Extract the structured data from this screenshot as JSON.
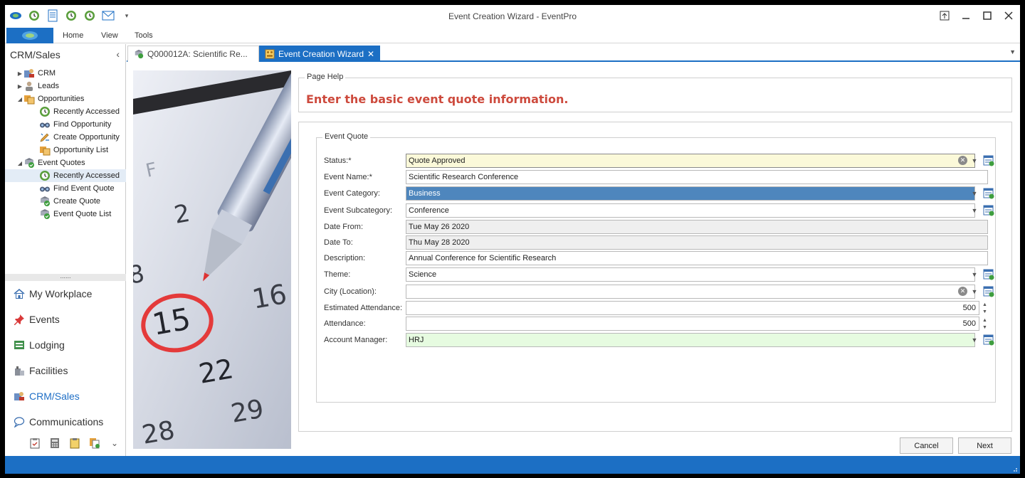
{
  "window": {
    "title": "Event Creation Wizard - EventPro"
  },
  "qat": {
    "icons": [
      "eventpro-logo-icon",
      "refresh-icon",
      "document-icon",
      "clock-icon",
      "clock-icon",
      "mail-icon",
      "customize-icon"
    ]
  },
  "ribbon": {
    "tabs": [
      "Home",
      "View",
      "Tools"
    ]
  },
  "nav": {
    "header": "CRM/Sales",
    "tree": [
      {
        "label": "CRM",
        "level": 1,
        "expanded": false
      },
      {
        "label": "Leads",
        "level": 1,
        "expanded": false
      },
      {
        "label": "Opportunities",
        "level": 1,
        "expanded": true
      },
      {
        "label": "Recently Accessed",
        "level": 2
      },
      {
        "label": "Find Opportunity",
        "level": 2
      },
      {
        "label": "Create Opportunity",
        "level": 2
      },
      {
        "label": "Opportunity List",
        "level": 2
      },
      {
        "label": "Event Quotes",
        "level": 1,
        "expanded": true
      },
      {
        "label": "Recently Accessed",
        "level": 2,
        "selected": true
      },
      {
        "label": "Find Event Quote",
        "level": 2
      },
      {
        "label": "Create Quote",
        "level": 2
      },
      {
        "label": "Event Quote List",
        "level": 2
      }
    ],
    "splitter": "......",
    "big": [
      {
        "label": "My Workplace",
        "active": false
      },
      {
        "label": "Events",
        "active": false
      },
      {
        "label": "Lodging",
        "active": false
      },
      {
        "label": "Facilities",
        "active": false
      },
      {
        "label": "CRM/Sales",
        "active": true
      },
      {
        "label": "Communications",
        "active": false
      }
    ]
  },
  "tabs": {
    "inactive": "Q000012A: Scientific Re...",
    "active": "Event Creation Wizard",
    "close": "✕"
  },
  "pagehelp": {
    "legend": "Page Help",
    "text": "Enter the basic event quote information."
  },
  "form": {
    "legend": "Event Quote",
    "fields": {
      "status": {
        "label": "Status:*",
        "value": "Quote Approved"
      },
      "event_name": {
        "label": "Event Name:*",
        "value": "Scientific Research Conference"
      },
      "event_category": {
        "label": "Event Category:",
        "value": "Business"
      },
      "event_subcategory": {
        "label": "Event Subcategory:",
        "value": "Conference"
      },
      "date_from": {
        "label": "Date From:",
        "value": "Tue May 26 2020"
      },
      "date_to": {
        "label": "Date To:",
        "value": "Thu May 28 2020"
      },
      "description": {
        "label": "Description:",
        "value": "Annual Conference for Scientific Research"
      },
      "theme": {
        "label": "Theme:",
        "value": "Science"
      },
      "city": {
        "label": "City (Location):",
        "value": ""
      },
      "estimated_attendance": {
        "label": "Estimated Attendance:",
        "value": "500"
      },
      "attendance": {
        "label": "Attendance:",
        "value": "500"
      },
      "account_manager": {
        "label": "Account Manager:",
        "value": "HRJ"
      }
    }
  },
  "buttons": {
    "cancel": "Cancel",
    "next": "Next"
  },
  "colors": {
    "accent": "#1c6fc4",
    "help_text": "#cd4a3d",
    "required_bg": "#fbf9d9",
    "manager_bg": "#e6fbe0",
    "selected_bg": "#4e86bd"
  }
}
